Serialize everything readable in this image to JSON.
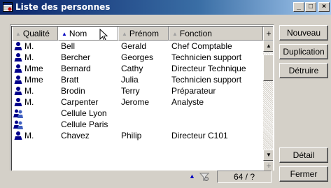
{
  "window": {
    "title": "Liste des personnes",
    "controls": {
      "minimize": "_",
      "maximize": "□",
      "close": "×"
    }
  },
  "columns": [
    "Qualité",
    "Nom",
    "Prénom",
    "Fonction"
  ],
  "sort_column": "Nom",
  "add_column": "+",
  "rows": [
    {
      "type": "person",
      "qualite": "M.",
      "nom": "Bell",
      "prenom": "Gerald",
      "fonction": "Chef Comptable"
    },
    {
      "type": "person",
      "qualite": "M.",
      "nom": "Bercher",
      "prenom": "Georges",
      "fonction": "Technicien support"
    },
    {
      "type": "person",
      "qualite": "Mme",
      "nom": "Bernard",
      "prenom": "Cathy",
      "fonction": "Directeur Technique"
    },
    {
      "type": "person",
      "qualite": "Mme",
      "nom": "Bratt",
      "prenom": "Julia",
      "fonction": "Technicien support"
    },
    {
      "type": "person",
      "qualite": "M.",
      "nom": "Brodin",
      "prenom": "Terry",
      "fonction": "Préparateur"
    },
    {
      "type": "person",
      "qualite": "M.",
      "nom": "Carpenter",
      "prenom": "Jerome",
      "fonction": "Analyste"
    },
    {
      "type": "group",
      "qualite": "",
      "nom": "Cellule Lyon",
      "prenom": "",
      "fonction": ""
    },
    {
      "type": "group",
      "qualite": "",
      "nom": "Cellule Paris",
      "prenom": "",
      "fonction": ""
    },
    {
      "type": "person",
      "qualite": "M.",
      "nom": "Chavez",
      "prenom": "Philip",
      "fonction": "Directeur C101"
    }
  ],
  "status": {
    "count": "64 / ?"
  },
  "buttons": {
    "nouveau": "Nouveau",
    "duplication": "Duplication",
    "detruire": "Détruire",
    "detail": "Détail",
    "fermer": "Fermer"
  },
  "colors": {
    "title_start": "#0a246a",
    "title_end": "#a6caf0",
    "face": "#d4d0c8",
    "person_icon": "#00008b"
  }
}
